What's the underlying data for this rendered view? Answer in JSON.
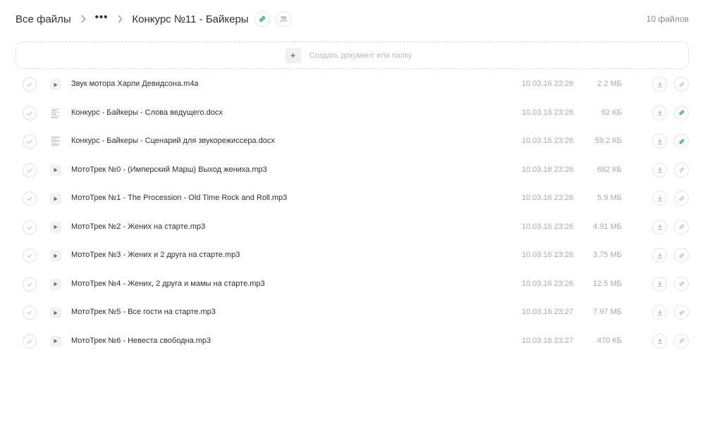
{
  "header": {
    "root_label": "Все файлы",
    "more_label": "•••",
    "folder_title": "Конкурс №11 - Байкеры",
    "file_count": "10 файлов"
  },
  "create": {
    "plus": "+",
    "label": "Создать документ или папку"
  },
  "colors": {
    "link_active": "#2fa84f",
    "icon_muted": "#c4c4c4"
  },
  "files": [
    {
      "name": "Звук мотора Харли Девидсона.m4a",
      "date": "10.03.16 23:26",
      "size": "2.2 МБ",
      "type": "audio",
      "link_active": false
    },
    {
      "name": "Конкурс - Байкеры - Слова ведущего.docx",
      "date": "10.03.16 23:26",
      "size": "62 КБ",
      "type": "doc",
      "link_active": true
    },
    {
      "name": "Конкурс - Байкеры - Сценарий для звукорежиссера.docx",
      "date": "10.03.16 23:26",
      "size": "59.2 КБ",
      "type": "doc",
      "link_active": true
    },
    {
      "name": "МотоТрек №0 - (Имперский Марш) Выход жениха.mp3",
      "date": "10.03.16 23:26",
      "size": "682 КБ",
      "type": "audio",
      "link_active": false
    },
    {
      "name": "МотоТрек №1 - The Procession - Old Time Rock and Roll.mp3",
      "date": "10.03.16 23:26",
      "size": "5.9 МБ",
      "type": "audio",
      "link_active": false
    },
    {
      "name": "МотоТрек №2 - Жених на старте.mp3",
      "date": "10.03.16 23:26",
      "size": "4.91 МБ",
      "type": "audio",
      "link_active": false
    },
    {
      "name": "МотоТрек №3 - Жених и 2 друга на старте.mp3",
      "date": "10.03.16 23:26",
      "size": "3.75 МБ",
      "type": "audio",
      "link_active": false
    },
    {
      "name": "МотоТрек №4 - Жених, 2 друга и мамы на старте.mp3",
      "date": "10.03.16 23:26",
      "size": "12.5 МБ",
      "type": "audio",
      "link_active": false
    },
    {
      "name": "МотоТрек №5 - Все гости на старте.mp3",
      "date": "10.03.16 23:27",
      "size": "7.97 МБ",
      "type": "audio",
      "link_active": false
    },
    {
      "name": "МотоТрек №6 - Невеста свободна.mp3",
      "date": "10.03.16 23:27",
      "size": "470 КБ",
      "type": "audio",
      "link_active": false
    }
  ]
}
